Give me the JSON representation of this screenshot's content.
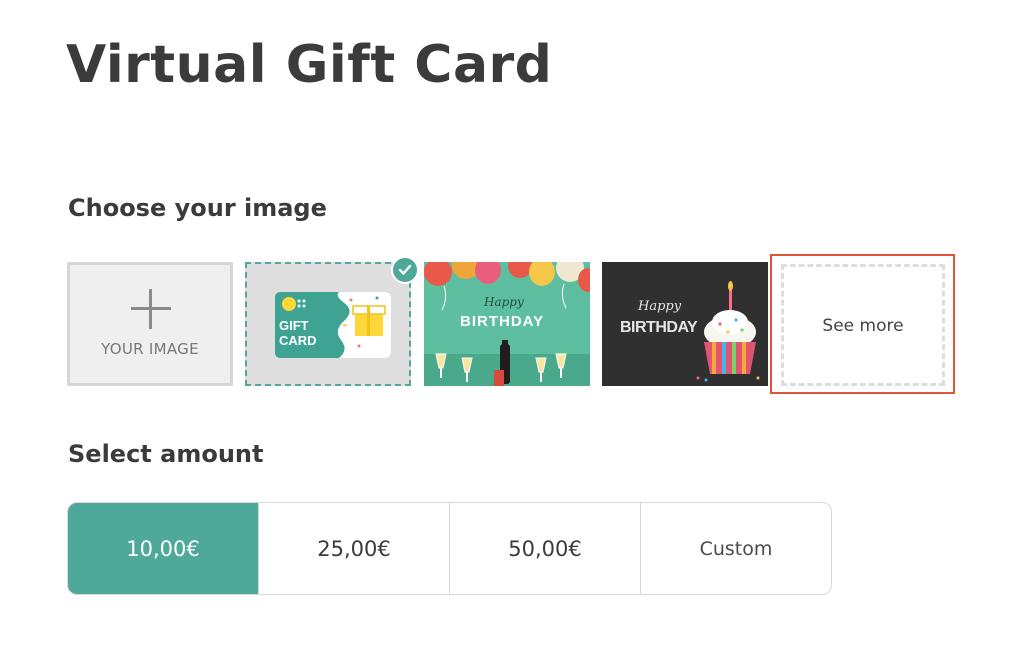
{
  "page": {
    "title": "Virtual Gift Card"
  },
  "image_section": {
    "heading": "Choose your image",
    "upload_label": "YOUR IMAGE",
    "see_more_label": "See more",
    "images": [
      {
        "name": "gift-card",
        "text_line1": "GIFT",
        "text_line2": "CARD",
        "selected": true
      },
      {
        "name": "happy-birthday-balloons",
        "text_top": "Happy",
        "text_main": "BIRTHDAY",
        "selected": false
      },
      {
        "name": "happy-birthday-cupcake",
        "text_top": "Happy",
        "text_main": "BIRTHDAY",
        "selected": false
      }
    ]
  },
  "amount_section": {
    "heading": "Select amount",
    "options": [
      {
        "label": "10,00€",
        "selected": true
      },
      {
        "label": "25,00€",
        "selected": false
      },
      {
        "label": "50,00€",
        "selected": false
      },
      {
        "label": "Custom",
        "selected": false
      }
    ]
  },
  "colors": {
    "accent": "#4fa99b",
    "highlight_border": "#e2543a",
    "text": "#3b3b3b"
  },
  "icons": {
    "upload": "plus-icon",
    "selected_badge": "checkmark-icon"
  }
}
